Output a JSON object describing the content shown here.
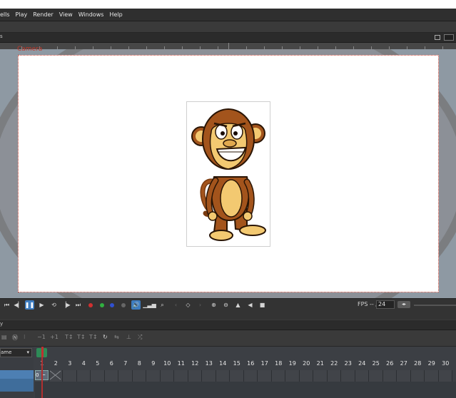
{
  "menu": {
    "items": [
      "ells",
      "Play",
      "Render",
      "View",
      "Windows",
      "Help"
    ]
  },
  "camera_panel": {
    "header_label": "s",
    "camera_label": "Camera"
  },
  "transport": {
    "fps_label": "FPS -- / ",
    "fps_value": "24",
    "spin_label": "◂▸"
  },
  "timeline_panel": {
    "header_label": "y",
    "tool_plus1_a": "−1",
    "tool_plus1_b": "+1",
    "layer_name_label": "ame",
    "cell_value": "0",
    "frame_numbers": [
      "1",
      "2",
      "3",
      "4",
      "5",
      "6",
      "7",
      "8",
      "9",
      "10",
      "11",
      "12",
      "13",
      "14",
      "15",
      "16",
      "17",
      "18",
      "19",
      "20",
      "21",
      "22",
      "23",
      "24",
      "25",
      "26",
      "27",
      "28",
      "29",
      "30"
    ]
  },
  "colors": {
    "accent_blue": "#3d7cc0",
    "playhead_red": "#b03030",
    "record_red": "#d03030",
    "record_green": "#30b040",
    "record_blue": "#3050d0"
  },
  "icons": [
    "first-frame-icon",
    "prev-frame-icon",
    "pause-icon",
    "play-icon",
    "loop-icon",
    "next-frame-icon",
    "last-frame-icon",
    "sound-icon",
    "zoom-icon",
    "zoom-in-icon",
    "zoom-out-icon"
  ]
}
